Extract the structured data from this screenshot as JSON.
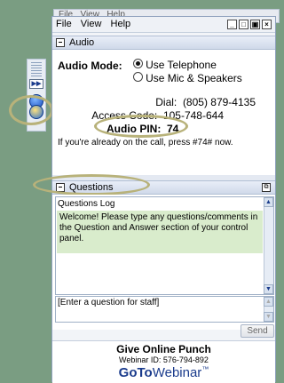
{
  "ghost_menu": [
    "File",
    "View",
    "Help"
  ],
  "menu": [
    "File",
    "View",
    "Help"
  ],
  "window_buttons": [
    "minimize",
    "restore",
    "maximize",
    "close"
  ],
  "audio": {
    "header": "Audio",
    "mode_label": "Audio Mode:",
    "options": [
      {
        "label": "Use Telephone",
        "selected": true
      },
      {
        "label": "Use Mic & Speakers",
        "selected": false
      }
    ],
    "dial_label": "Dial:",
    "dial_value": "(805) 879-4135",
    "access_label": "Access Code:",
    "access_value": "105-748-644",
    "pin_label": "Audio PIN:",
    "pin_value": "74",
    "note": "If you're already on the call, press #74# now."
  },
  "questions": {
    "header": "Questions",
    "log_title": "Questions Log",
    "welcome": "Welcome! Please type any questions/comments in the Question and Answer section of your control panel.",
    "input_placeholder": "[Enter a question for staff]",
    "send_label": "Send"
  },
  "footer": {
    "title": "Give Online Punch",
    "webinar_id": "Webinar ID: 576-794-892",
    "brand_goto": "GoTo",
    "brand_webinar": "Webinar",
    "brand_tm": "™"
  },
  "toolbar": {
    "icons": [
      "grip-icon",
      "expand-icon",
      "screen-icon",
      "hand-raise-icon"
    ]
  },
  "colors": {
    "highlight_oval": "#b8b27a",
    "brand_blue": "#1a3b8c",
    "welcome_bg": "#d9eccc"
  }
}
